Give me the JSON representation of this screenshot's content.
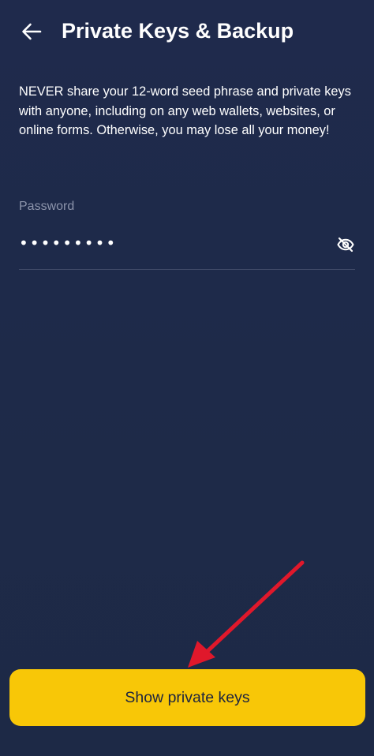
{
  "header": {
    "title": "Private Keys & Backup",
    "back_icon": "arrow-left-icon"
  },
  "warning": {
    "text": "NEVER share your 12-word seed phrase and private keys with anyone, including on any web wallets, websites, or online forms. Otherwise, you may lose all your money!"
  },
  "password": {
    "label": "Password",
    "masked_value": "•••••••••",
    "visibility_icon": "eye-off-icon"
  },
  "action": {
    "label": "Show private keys",
    "color": "#f8c707"
  },
  "annotation": {
    "arrow_color": "#e0182b"
  }
}
